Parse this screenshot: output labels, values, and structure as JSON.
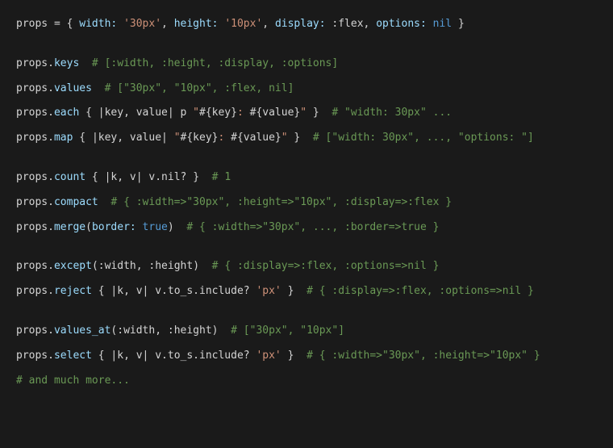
{
  "lines": {
    "l1": {
      "var": "props",
      "eq": " = ",
      "br1": "{ ",
      "k1": "width:",
      "v1": " '30px'",
      "c1": ", ",
      "k2": "height:",
      "v2": " '10px'",
      "c2": ", ",
      "k3": "display:",
      "v3": " :flex",
      "c3": ", ",
      "k4": "options:",
      "v4": " nil",
      "br2": " }"
    },
    "l2": {
      "obj": "props",
      "dot": ".",
      "method": "keys",
      "comment": "  # [:width, :height, :display, :options]"
    },
    "l3": {
      "obj": "props",
      "dot": ".",
      "method": "values",
      "comment": "  # [\"30px\", \"10px\", :flex, nil]"
    },
    "l4": {
      "obj": "props",
      "dot": ".",
      "method": "each",
      "block1": " { ",
      "pipe1": "|key, value|",
      "p": " p ",
      "str1": "\"",
      "int1": "#{key}",
      "mid": ": ",
      "int2": "#{value}",
      "str2": "\"",
      "block2": " }",
      "comment": "  # \"width: 30px\" ..."
    },
    "l5": {
      "obj": "props",
      "dot": ".",
      "method": "map",
      "block1": " { ",
      "pipe1": "|key, value|",
      "sp": " ",
      "str1": "\"",
      "int1": "#{key}",
      "mid": ": ",
      "int2": "#{value}",
      "str2": "\"",
      "block2": " }",
      "comment": "  # [\"width: 30px\", ..., \"options: \"]"
    },
    "l6": {
      "obj": "props",
      "dot": ".",
      "method": "count",
      "block1": " { ",
      "pipe1": "|k, v|",
      "body": " v.nil? ",
      "block2": "}",
      "comment": "  # 1"
    },
    "l7": {
      "obj": "props",
      "dot": ".",
      "method": "compact",
      "comment": "  # { :width=>\"30px\", :height=>\"10px\", :display=>:flex }"
    },
    "l8": {
      "obj": "props",
      "dot": ".",
      "method": "merge",
      "paren1": "(",
      "arg1": "border:",
      "val1": " true",
      "paren2": ")",
      "comment": "  # { :width=>\"30px\", ..., :border=>true }"
    },
    "l9": {
      "obj": "props",
      "dot": ".",
      "method": "except",
      "paren1": "(",
      "arg1": ":width",
      "c1": ", ",
      "arg2": ":height",
      "paren2": ")",
      "comment": "  # { :display=>:flex, :options=>nil }"
    },
    "l10": {
      "obj": "props",
      "dot": ".",
      "method": "reject",
      "block1": " { ",
      "pipe1": "|k, v|",
      "body": " v.to_s.include? ",
      "str": "'px'",
      "block2": " }",
      "comment": "  # { :display=>:flex, :options=>nil }"
    },
    "l11": {
      "obj": "props",
      "dot": ".",
      "method": "values_at",
      "paren1": "(",
      "arg1": ":width",
      "c1": ", ",
      "arg2": ":height",
      "paren2": ")",
      "comment": "  # [\"30px\", \"10px\"]"
    },
    "l12": {
      "obj": "props",
      "dot": ".",
      "method": "select",
      "block1": " { ",
      "pipe1": "|k, v|",
      "body": " v.to_s.include? ",
      "str": "'px'",
      "block2": " }",
      "comment": "  # { :width=>\"30px\", :height=>\"10px\" }"
    },
    "l13": {
      "comment": "# and much more..."
    }
  }
}
